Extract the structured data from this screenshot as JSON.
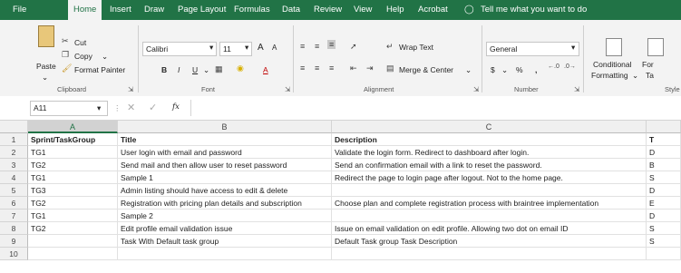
{
  "tabs": [
    "File",
    "Home",
    "Insert",
    "Draw",
    "Page Layout",
    "Formulas",
    "Data",
    "Review",
    "View",
    "Help",
    "Acrobat",
    "Tell me what you want to do"
  ],
  "clipboard": {
    "paste": "Paste",
    "cut": "Cut",
    "copy": "Copy",
    "format_painter": "Format Painter",
    "label": "Clipboard"
  },
  "font": {
    "name": "Calibri",
    "size": "11",
    "label": "Font",
    "bold": "B",
    "italic": "I",
    "underline": "U",
    "grow": "A",
    "shrink": "A",
    "color": "A"
  },
  "alignment": {
    "wrap": "Wrap Text",
    "merge": "Merge & Center",
    "label": "Alignment"
  },
  "number": {
    "format": "General",
    "label": "Number",
    "currency": "$",
    "percent": "%",
    "comma": ","
  },
  "styles": {
    "conditional_1": "Conditional",
    "conditional_2": "Formatting",
    "format_table_1": "For",
    "format_table_2": "Ta",
    "label": "Style"
  },
  "formula_bar": {
    "name_box": "A11",
    "fx": "fx",
    "value": ""
  },
  "columns": [
    "A",
    "B",
    "C"
  ],
  "rows": [
    {
      "num": "1",
      "a": "Sprint/TaskGroup",
      "b": "Title",
      "c": "Description",
      "d": "T"
    },
    {
      "num": "2",
      "a": "TG1",
      "b": "User login with email and password",
      "c": "Validate the login form. Redirect to dashboard after login.",
      "d": "D"
    },
    {
      "num": "3",
      "a": "TG2",
      "b": "Send mail and then allow user to reset password",
      "c": "Send an confirmation email with a link to reset the password.",
      "d": "B"
    },
    {
      "num": "4",
      "a": "TG1",
      "b": "Sample 1",
      "c": "Redirect the page to login page after logout. Not to the home page.",
      "d": "S"
    },
    {
      "num": "5",
      "a": "TG3",
      "b": "Admin listing should have access to edit & delete",
      "c": "",
      "d": "D"
    },
    {
      "num": "6",
      "a": "TG2",
      "b": "Registration with pricing plan details and subscription",
      "c": "Choose plan and complete registration process with braintree implementation",
      "d": "E"
    },
    {
      "num": "7",
      "a": "TG1",
      "b": "Sample 2",
      "c": "",
      "d": "D"
    },
    {
      "num": "8",
      "a": "TG2",
      "b": "Edit profile email validation issue",
      "c": "Issue on email validation on edit profile. Allowing two dot on email ID",
      "d": "S"
    },
    {
      "num": "9",
      "a": "",
      "b": "Task With Default task group",
      "c": "Default Task group Task Description",
      "d": "S"
    },
    {
      "num": "10",
      "a": "",
      "b": "",
      "c": "",
      "d": ""
    }
  ]
}
